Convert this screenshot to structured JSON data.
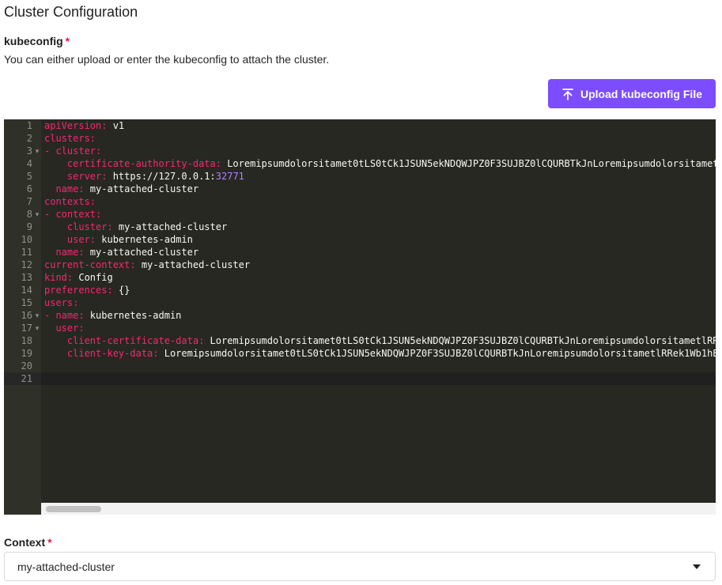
{
  "page": {
    "title": "Cluster Configuration"
  },
  "kubeconfig": {
    "label": "kubeconfig",
    "required_mark": "*",
    "description": "You can either upload or enter the kubeconfig to attach the cluster.",
    "upload_button_label": "Upload kubeconfig File",
    "upload_icon": "upload-arrow-icon"
  },
  "editor": {
    "theme": {
      "background": "#272822",
      "key_color": "#f92672",
      "number_color": "#ae81ff",
      "text_color": "#f8f8f2"
    },
    "active_line": 21,
    "lines": [
      {
        "n": "1",
        "fold": "",
        "indent": "",
        "dash": "",
        "key": "apiVersion:",
        "value": " v1",
        "num": ""
      },
      {
        "n": "2",
        "fold": "",
        "indent": "",
        "dash": "",
        "key": "clusters:",
        "value": "",
        "num": ""
      },
      {
        "n": "3",
        "fold": "▾",
        "indent": "",
        "dash": "- ",
        "key": "cluster:",
        "value": "",
        "num": ""
      },
      {
        "n": "4",
        "fold": "",
        "indent": "    ",
        "dash": "",
        "key": "certificate-authority-data:",
        "value": " Loremipsumdolorsitamet0tLS0tCk1JSUN5ekNDQWJPZ0F3SUJBZ0lCQURBTkJnLoremipsumdolorsitamet",
        "num": ""
      },
      {
        "n": "5",
        "fold": "",
        "indent": "    ",
        "dash": "",
        "key": "server:",
        "value": " https://127.0.0.1:",
        "num": "32771"
      },
      {
        "n": "6",
        "fold": "",
        "indent": "  ",
        "dash": "",
        "key": "name:",
        "value": " my-attached-cluster",
        "num": ""
      },
      {
        "n": "7",
        "fold": "",
        "indent": "",
        "dash": "",
        "key": "contexts:",
        "value": "",
        "num": ""
      },
      {
        "n": "8",
        "fold": "▾",
        "indent": "",
        "dash": "- ",
        "key": "context:",
        "value": "",
        "num": ""
      },
      {
        "n": "9",
        "fold": "",
        "indent": "    ",
        "dash": "",
        "key": "cluster:",
        "value": " my-attached-cluster",
        "num": ""
      },
      {
        "n": "10",
        "fold": "",
        "indent": "    ",
        "dash": "",
        "key": "user:",
        "value": " kubernetes-admin",
        "num": ""
      },
      {
        "n": "11",
        "fold": "",
        "indent": "  ",
        "dash": "",
        "key": "name:",
        "value": " my-attached-cluster",
        "num": ""
      },
      {
        "n": "12",
        "fold": "",
        "indent": "",
        "dash": "",
        "key": "current-context:",
        "value": " my-attached-cluster",
        "num": ""
      },
      {
        "n": "13",
        "fold": "",
        "indent": "",
        "dash": "",
        "key": "kind:",
        "value": " Config",
        "num": ""
      },
      {
        "n": "14",
        "fold": "",
        "indent": "",
        "dash": "",
        "key": "preferences:",
        "value": " {}",
        "num": ""
      },
      {
        "n": "15",
        "fold": "",
        "indent": "",
        "dash": "",
        "key": "users:",
        "value": "",
        "num": ""
      },
      {
        "n": "16",
        "fold": "▾",
        "indent": "",
        "dash": "- ",
        "key": "name:",
        "value": " kubernetes-admin",
        "num": ""
      },
      {
        "n": "17",
        "fold": "▾",
        "indent": "  ",
        "dash": "",
        "key": "user:",
        "value": "",
        "num": ""
      },
      {
        "n": "18",
        "fold": "",
        "indent": "    ",
        "dash": "",
        "key": "client-certificate-data:",
        "value": " Loremipsumdolorsitamet0tLS0tCk1JSUN5ekNDQWJPZ0F3SUJBZ0lCQURBTkJnLoremipsumdolorsitametlRR",
        "num": ""
      },
      {
        "n": "19",
        "fold": "",
        "indent": "    ",
        "dash": "",
        "key": "client-key-data:",
        "value": " Loremipsumdolorsitamet0tLS0tCk1JSUN5ekNDQWJPZ0F3SUJBZ0lCQURBTkJnLoremipsumdolorsitametlRRek1Wb1hE",
        "num": ""
      },
      {
        "n": "20",
        "fold": "",
        "indent": "",
        "dash": "",
        "key": "",
        "value": "",
        "num": ""
      },
      {
        "n": "21",
        "fold": "",
        "indent": "",
        "dash": "",
        "key": "",
        "value": "",
        "num": ""
      }
    ]
  },
  "context": {
    "label": "Context",
    "required_mark": "*",
    "selected": "my-attached-cluster",
    "caret_icon": "caret-down-icon"
  }
}
